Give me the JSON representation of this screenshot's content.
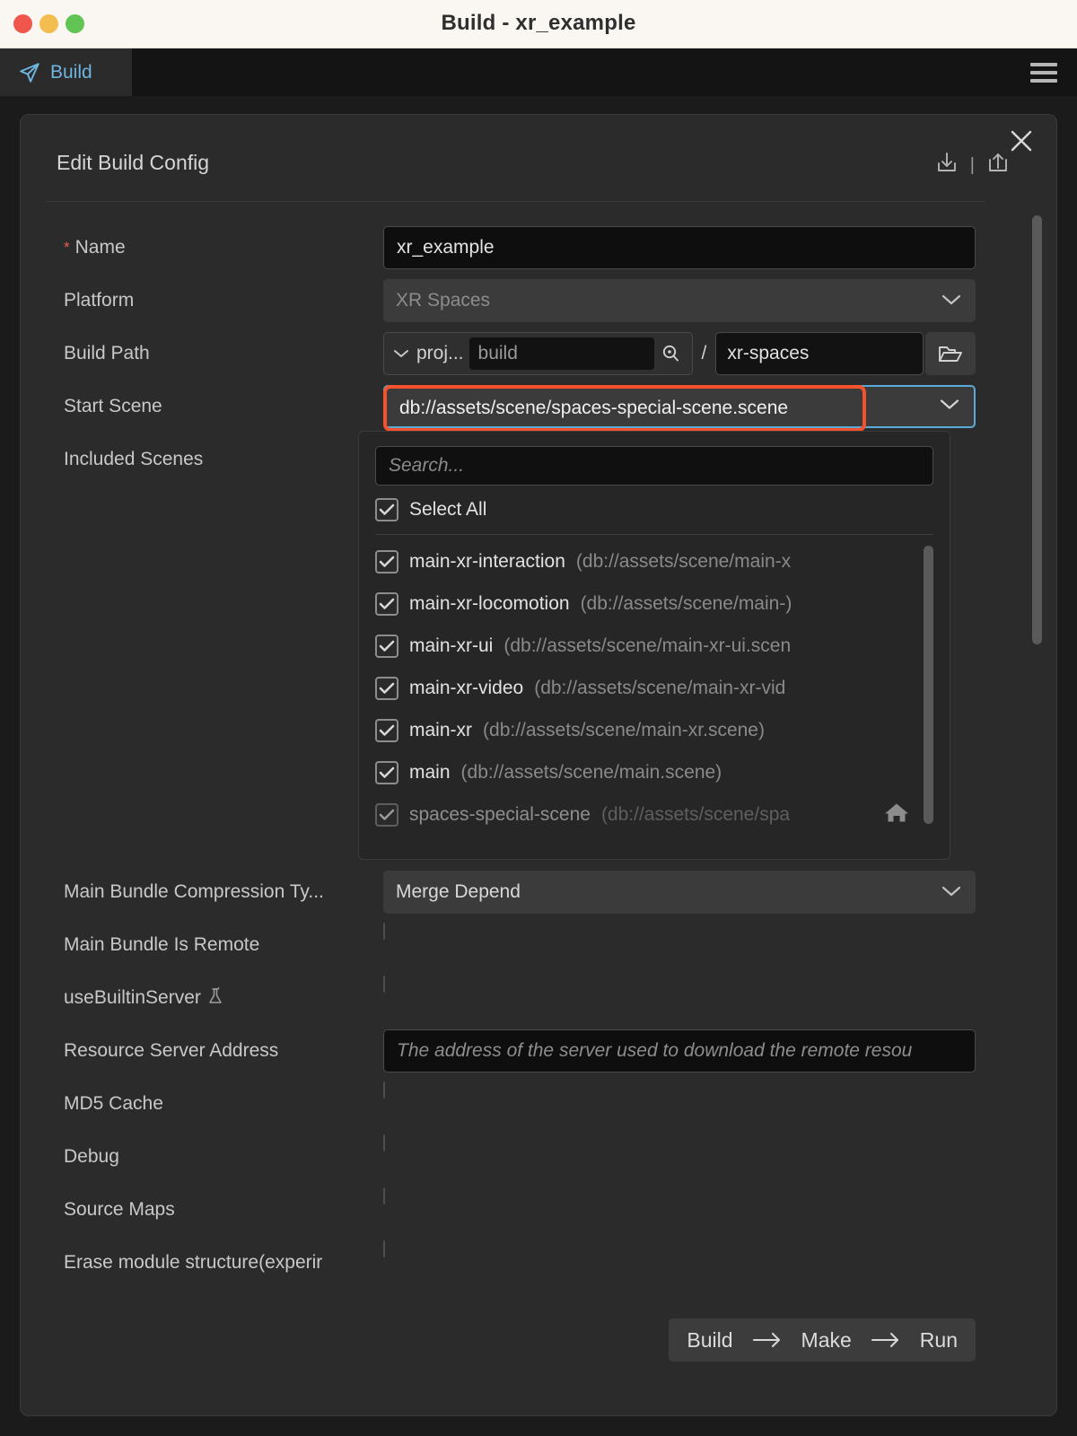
{
  "window": {
    "title": "Build - xr_example",
    "traffic_lights": [
      "close",
      "minimize",
      "zoom"
    ]
  },
  "tabbar": {
    "tab_label": "Build",
    "menu_icon": "hamburger-menu-icon"
  },
  "panel": {
    "title": "Edit Build Config",
    "close_icon": "close-icon",
    "import_icon": "import-icon",
    "export_icon": "export-icon",
    "separator": "|"
  },
  "form": {
    "name": {
      "label": "Name",
      "required_marker": "*",
      "value": "xr_example"
    },
    "platform": {
      "label": "Platform",
      "value": "XR Spaces"
    },
    "build_path": {
      "label": "Build Path",
      "root": "proj...",
      "folder_value": "build",
      "separator": "/",
      "tail_value": "xr-spaces",
      "search_icon": "search-icon",
      "browse_icon": "folder-open-icon"
    },
    "start_scene": {
      "label": "Start Scene",
      "value": "db://assets/scene/spaces-special-scene.scene"
    },
    "included_scenes": {
      "label": "Included Scenes",
      "search_placeholder": "Search...",
      "select_all_label": "Select All",
      "select_all_checked": true,
      "items": [
        {
          "name": "main-xr-interaction",
          "path": "(db://assets/scene/main-x",
          "checked": true,
          "dim": false,
          "home": false
        },
        {
          "name": "main-xr-locomotion",
          "path": "(db://assets/scene/main-)",
          "checked": true,
          "dim": false,
          "home": false
        },
        {
          "name": "main-xr-ui",
          "path": "(db://assets/scene/main-xr-ui.scen",
          "checked": true,
          "dim": false,
          "home": false
        },
        {
          "name": "main-xr-video",
          "path": "(db://assets/scene/main-xr-vid",
          "checked": true,
          "dim": false,
          "home": false
        },
        {
          "name": "main-xr",
          "path": "(db://assets/scene/main-xr.scene)",
          "checked": true,
          "dim": false,
          "home": false
        },
        {
          "name": "main",
          "path": "(db://assets/scene/main.scene)",
          "checked": true,
          "dim": false,
          "home": false
        },
        {
          "name": "spaces-special-scene",
          "path": "(db://assets/scene/spa",
          "checked": true,
          "dim": true,
          "home": true
        }
      ]
    },
    "compression": {
      "label": "Main Bundle Compression Ty...",
      "value": "Merge Depend"
    },
    "bundle_remote": {
      "label": "Main Bundle Is Remote",
      "checked": false
    },
    "builtin_server": {
      "label": "useBuiltinServer",
      "checked": false,
      "icon": "flask-experimental-icon"
    },
    "resource_server": {
      "label": "Resource Server Address",
      "placeholder": "The address of the server used to download the remote resou"
    },
    "md5_cache": {
      "label": "MD5 Cache",
      "checked": false
    },
    "debug": {
      "label": "Debug",
      "checked": false
    },
    "source_maps": {
      "label": "Source Maps",
      "checked": false
    },
    "erase_module": {
      "label": "Erase module structure(experir",
      "checked": false
    }
  },
  "actions": {
    "build": "Build",
    "make": "Make",
    "run": "Run",
    "arrow": "→"
  },
  "colors": {
    "accent_blue": "#6eb5e0",
    "focus_blue": "#5aa9d6",
    "highlight_red": "#f4512c",
    "required_red": "#e0614f",
    "panel_bg": "#2b2b2b",
    "window_bg": "#1b1b1b",
    "titlebar_bg": "#faf7f2"
  }
}
